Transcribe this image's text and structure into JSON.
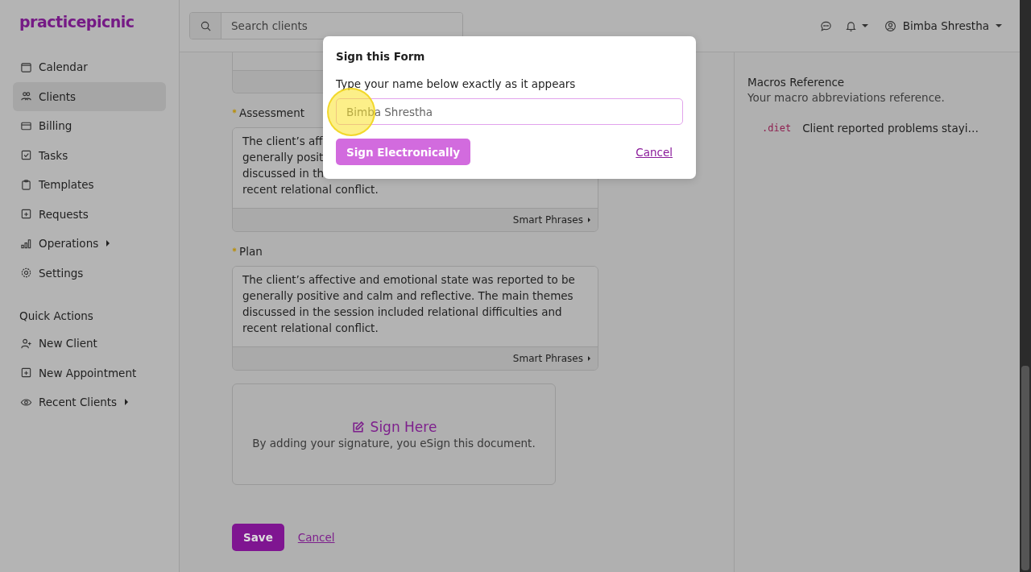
{
  "logo": "practicepicnic",
  "sidebar": {
    "items": [
      {
        "label": "Calendar",
        "selected": false,
        "has_submenu": false
      },
      {
        "label": "Clients",
        "selected": true,
        "has_submenu": false
      },
      {
        "label": "Billing",
        "selected": false,
        "has_submenu": false
      },
      {
        "label": "Tasks",
        "selected": false,
        "has_submenu": false
      },
      {
        "label": "Templates",
        "selected": false,
        "has_submenu": false
      },
      {
        "label": "Requests",
        "selected": false,
        "has_submenu": false
      },
      {
        "label": "Operations",
        "selected": false,
        "has_submenu": true
      },
      {
        "label": "Settings",
        "selected": false,
        "has_submenu": false
      }
    ],
    "quick_actions_title": "Quick Actions",
    "quick_actions": [
      {
        "label": "New Client",
        "has_submenu": false
      },
      {
        "label": "New Appointment",
        "has_submenu": false
      },
      {
        "label": "Recent Clients",
        "has_submenu": true
      }
    ]
  },
  "header": {
    "search": {
      "placeholder": "Search clients"
    },
    "user": "Bimba Shrestha"
  },
  "form": {
    "fields": [
      {
        "label": "Assessment",
        "required": true,
        "lines": [
          "The client’s aff",
          "generally posit",
          "discussed in th",
          "recent relational conflict."
        ],
        "footer": "Smart Phrases"
      },
      {
        "label": "Plan",
        "required": true,
        "lines": [
          "The client’s affective and emotional state was reported to be",
          "generally positive and calm and reflective. The main themes",
          "discussed in the session included relational difficulties and",
          "recent relational conflict."
        ],
        "footer": "Smart Phrases"
      }
    ],
    "signature": {
      "title": "Sign Here",
      "note": "By adding your signature, you eSign this document."
    },
    "save": "Save",
    "cancel": "Cancel"
  },
  "macros": {
    "title": "Macros Reference",
    "subtitle": "Your macro abbreviations reference.",
    "items": [
      {
        "code": ".diet",
        "text": "Client reported problems stayi…"
      }
    ]
  },
  "dialog": {
    "title": "Sign this Form",
    "instruction": "Type your name below exactly as it appears",
    "input": {
      "placeholder": "Bimba Shrestha"
    },
    "sign_button": "Sign Electronically",
    "cancel": "Cancel"
  }
}
